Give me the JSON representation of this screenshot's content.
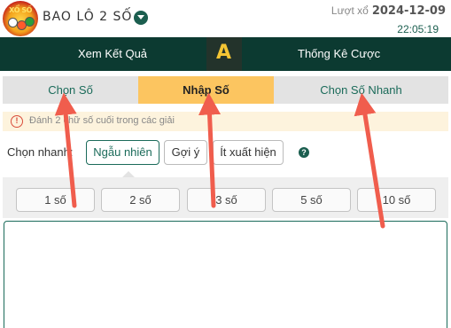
{
  "header": {
    "logo_text": "XỔ SỐ",
    "title": "BAO LÔ 2 SỐ",
    "draw_label": "Lượt xổ",
    "draw_date": "2024-12-09",
    "clock": "22:05:19"
  },
  "nav": {
    "results": "Xem Kết Quả",
    "badge": "A",
    "stats": "Thống Kê Cược"
  },
  "tabs": {
    "choose": "Chọn Số",
    "input": "Nhập Số",
    "quick": "Chọn Số Nhanh"
  },
  "notice": {
    "icon": "!",
    "text": "Đánh 2 chữ số cuối trong các giải"
  },
  "quick_select": {
    "label": "Chọn nhanh:",
    "options": [
      "Ngẫu nhiên",
      "Gợi ý",
      "Ít xuất hiện"
    ],
    "help": "?"
  },
  "counts": [
    "1 số",
    "2 số",
    "3 số",
    "5 số",
    "10 số"
  ],
  "annotation_color": "#f05d4d"
}
